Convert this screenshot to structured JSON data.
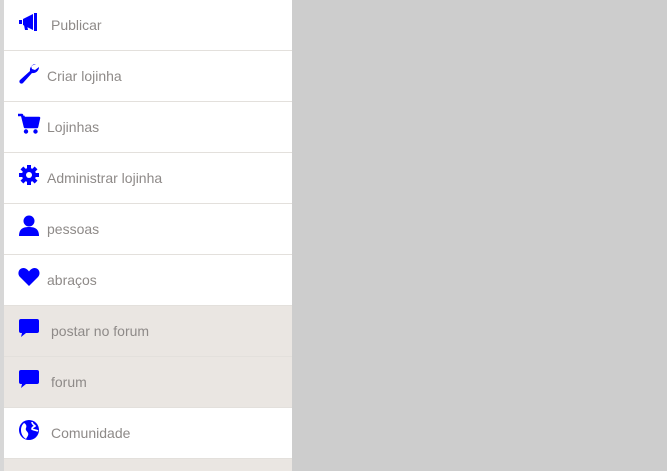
{
  "menu": {
    "items": [
      {
        "label": "Publicar",
        "icon": "megaphone-icon"
      },
      {
        "label": "Criar lojinha",
        "icon": "wrench-icon"
      },
      {
        "label": "Lojinhas",
        "icon": "shopping-cart-icon"
      },
      {
        "label": "Administrar lojinha",
        "icon": "gear-icon"
      },
      {
        "label": "pessoas",
        "icon": "user-icon"
      },
      {
        "label": "abraços",
        "icon": "heart-icon"
      },
      {
        "label": "postar no forum",
        "icon": "comment-icon"
      },
      {
        "label": "forum",
        "icon": "comment-icon"
      },
      {
        "label": "Comunidade",
        "icon": "globe-icon"
      }
    ]
  },
  "colors": {
    "icon": "#0000ff",
    "label": "#8e8a88",
    "item_bg": "#ffffff",
    "item_bg_alt": "#eae6e2",
    "background": "#cdcdcd"
  }
}
